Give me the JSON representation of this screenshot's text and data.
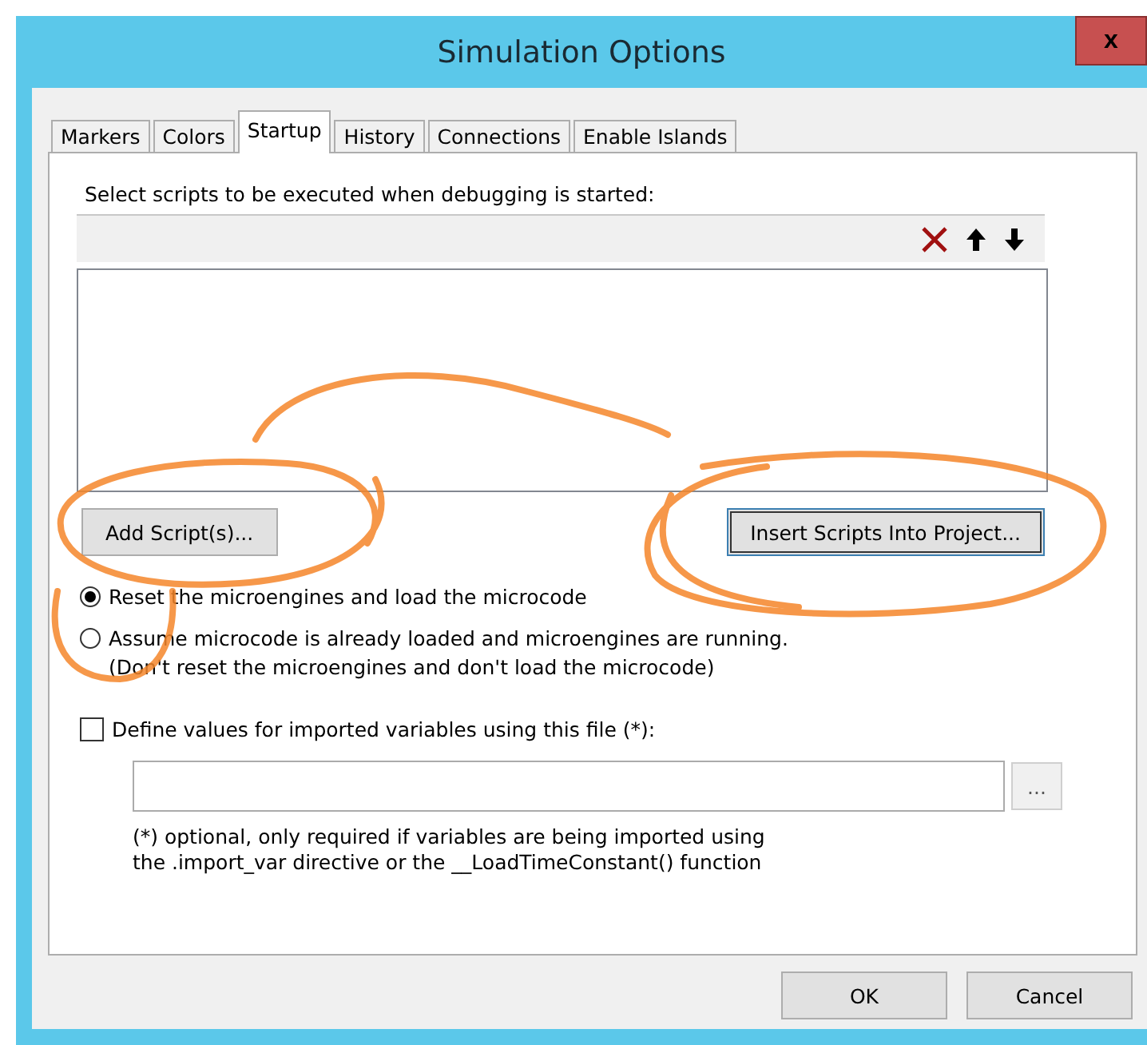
{
  "window": {
    "title": "Simulation Options",
    "close_label": "x"
  },
  "tabs": [
    {
      "label": "Markers",
      "selected": false
    },
    {
      "label": "Colors",
      "selected": false
    },
    {
      "label": "Startup",
      "selected": true
    },
    {
      "label": "History",
      "selected": false
    },
    {
      "label": "Connections",
      "selected": false
    },
    {
      "label": "Enable Islands",
      "selected": false
    }
  ],
  "startup": {
    "instruction": "Select scripts to be executed when debugging is started:",
    "add_button": "Add Script(s)...",
    "insert_button": "Insert Scripts Into Project...",
    "radios": [
      {
        "lines": [
          "Reset the microengines and load the microcode"
        ],
        "selected": true
      },
      {
        "lines": [
          "Assume microcode is already loaded and microengines are running.",
          "(Don't reset the microengines and don't load the microcode)"
        ],
        "selected": false
      }
    ],
    "checkbox": {
      "label": "Define values for imported variables using this file (*):",
      "checked": false
    },
    "browse_button": "...",
    "note": [
      "(*) optional, only required if variables are being imported using",
      "the .import_var directive or the __LoadTimeConstant() function"
    ]
  },
  "buttons": [
    "OK",
    "Cancel"
  ]
}
